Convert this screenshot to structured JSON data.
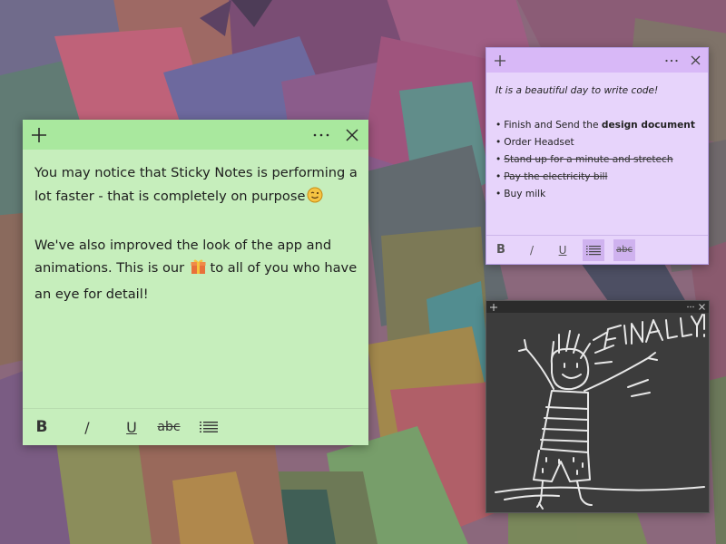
{
  "desktop": {
    "background": "#8e6a7a"
  },
  "notes": {
    "green": {
      "color": "#c6eebc",
      "titlebar_color": "#a9e89e",
      "icons": {
        "add": "plus-icon",
        "menu": "more-icon",
        "close": "close-icon"
      },
      "paragraphs": [
        {
          "text": "You may notice that Sticky Notes is performing a lot faster - that is completely on purpose",
          "emoji": "winking-face-emoji"
        },
        {
          "before": "We've also improved the look of the app and animations. This is our",
          "emoji": "gift-emoji",
          "after": "to all of you who have an eye for detail!"
        }
      ],
      "toolbar": {
        "bold": "B",
        "italic": "/",
        "underline": "U",
        "strikethrough": "abc",
        "list": "list-icon"
      }
    },
    "purple": {
      "color": "#e7d4fb",
      "titlebar_color": "#d8b8f7",
      "icons": {
        "add": "plus-icon",
        "menu": "more-icon",
        "close": "close-icon"
      },
      "headline": "It is a beautiful day to write code!",
      "items": [
        {
          "text": "Finish and Send the ",
          "bold": "design document",
          "done": false
        },
        {
          "text": "Order Headset",
          "bold": "",
          "done": false
        },
        {
          "text": "Stand up for a minute and stretech",
          "bold": "",
          "done": true
        },
        {
          "text": "Pay the electricity bill",
          "bold": "",
          "done": true
        },
        {
          "text": "Buy milk",
          "bold": "",
          "done": false
        }
      ],
      "bullet": "•",
      "toolbar": {
        "bold": "B",
        "italic": "/",
        "underline": "U",
        "strikethrough": "abc",
        "list": "list-icon",
        "active": [
          "list",
          "strikethrough"
        ]
      }
    },
    "dark": {
      "color": "#3c3c3c",
      "icons": {
        "add": "plus-icon",
        "menu": "more-icon",
        "close": "close-icon"
      },
      "ink_text": "FINALLY!",
      "ink_color": "#e8e8e8"
    }
  }
}
